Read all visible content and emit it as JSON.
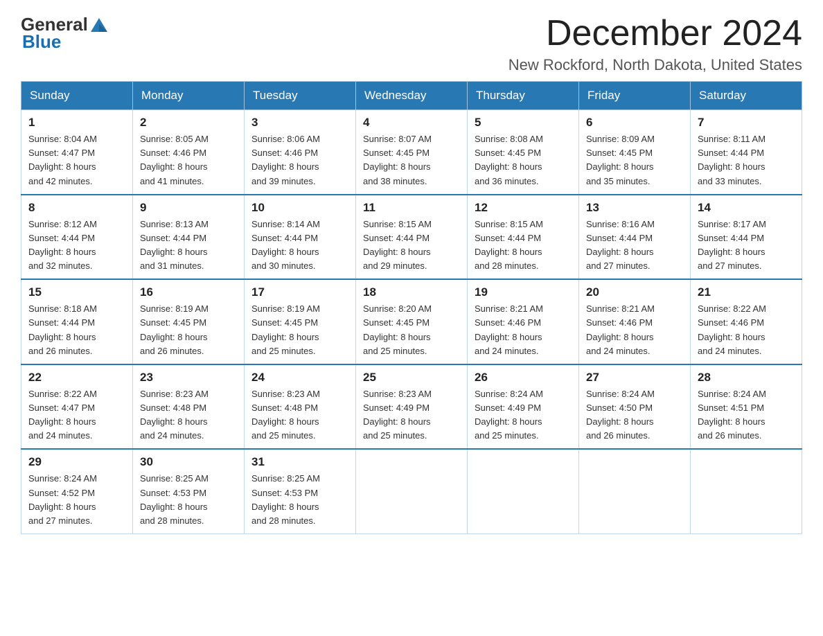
{
  "logo": {
    "text_general": "General",
    "text_blue": "Blue"
  },
  "header": {
    "month": "December 2024",
    "location": "New Rockford, North Dakota, United States"
  },
  "weekdays": [
    "Sunday",
    "Monday",
    "Tuesday",
    "Wednesday",
    "Thursday",
    "Friday",
    "Saturday"
  ],
  "weeks": [
    [
      {
        "day": "1",
        "sunrise": "8:04 AM",
        "sunset": "4:47 PM",
        "daylight": "8 hours and 42 minutes."
      },
      {
        "day": "2",
        "sunrise": "8:05 AM",
        "sunset": "4:46 PM",
        "daylight": "8 hours and 41 minutes."
      },
      {
        "day": "3",
        "sunrise": "8:06 AM",
        "sunset": "4:46 PM",
        "daylight": "8 hours and 39 minutes."
      },
      {
        "day": "4",
        "sunrise": "8:07 AM",
        "sunset": "4:45 PM",
        "daylight": "8 hours and 38 minutes."
      },
      {
        "day": "5",
        "sunrise": "8:08 AM",
        "sunset": "4:45 PM",
        "daylight": "8 hours and 36 minutes."
      },
      {
        "day": "6",
        "sunrise": "8:09 AM",
        "sunset": "4:45 PM",
        "daylight": "8 hours and 35 minutes."
      },
      {
        "day": "7",
        "sunrise": "8:11 AM",
        "sunset": "4:44 PM",
        "daylight": "8 hours and 33 minutes."
      }
    ],
    [
      {
        "day": "8",
        "sunrise": "8:12 AM",
        "sunset": "4:44 PM",
        "daylight": "8 hours and 32 minutes."
      },
      {
        "day": "9",
        "sunrise": "8:13 AM",
        "sunset": "4:44 PM",
        "daylight": "8 hours and 31 minutes."
      },
      {
        "day": "10",
        "sunrise": "8:14 AM",
        "sunset": "4:44 PM",
        "daylight": "8 hours and 30 minutes."
      },
      {
        "day": "11",
        "sunrise": "8:15 AM",
        "sunset": "4:44 PM",
        "daylight": "8 hours and 29 minutes."
      },
      {
        "day": "12",
        "sunrise": "8:15 AM",
        "sunset": "4:44 PM",
        "daylight": "8 hours and 28 minutes."
      },
      {
        "day": "13",
        "sunrise": "8:16 AM",
        "sunset": "4:44 PM",
        "daylight": "8 hours and 27 minutes."
      },
      {
        "day": "14",
        "sunrise": "8:17 AM",
        "sunset": "4:44 PM",
        "daylight": "8 hours and 27 minutes."
      }
    ],
    [
      {
        "day": "15",
        "sunrise": "8:18 AM",
        "sunset": "4:44 PM",
        "daylight": "8 hours and 26 minutes."
      },
      {
        "day": "16",
        "sunrise": "8:19 AM",
        "sunset": "4:45 PM",
        "daylight": "8 hours and 26 minutes."
      },
      {
        "day": "17",
        "sunrise": "8:19 AM",
        "sunset": "4:45 PM",
        "daylight": "8 hours and 25 minutes."
      },
      {
        "day": "18",
        "sunrise": "8:20 AM",
        "sunset": "4:45 PM",
        "daylight": "8 hours and 25 minutes."
      },
      {
        "day": "19",
        "sunrise": "8:21 AM",
        "sunset": "4:46 PM",
        "daylight": "8 hours and 24 minutes."
      },
      {
        "day": "20",
        "sunrise": "8:21 AM",
        "sunset": "4:46 PM",
        "daylight": "8 hours and 24 minutes."
      },
      {
        "day": "21",
        "sunrise": "8:22 AM",
        "sunset": "4:46 PM",
        "daylight": "8 hours and 24 minutes."
      }
    ],
    [
      {
        "day": "22",
        "sunrise": "8:22 AM",
        "sunset": "4:47 PM",
        "daylight": "8 hours and 24 minutes."
      },
      {
        "day": "23",
        "sunrise": "8:23 AM",
        "sunset": "4:48 PM",
        "daylight": "8 hours and 24 minutes."
      },
      {
        "day": "24",
        "sunrise": "8:23 AM",
        "sunset": "4:48 PM",
        "daylight": "8 hours and 25 minutes."
      },
      {
        "day": "25",
        "sunrise": "8:23 AM",
        "sunset": "4:49 PM",
        "daylight": "8 hours and 25 minutes."
      },
      {
        "day": "26",
        "sunrise": "8:24 AM",
        "sunset": "4:49 PM",
        "daylight": "8 hours and 25 minutes."
      },
      {
        "day": "27",
        "sunrise": "8:24 AM",
        "sunset": "4:50 PM",
        "daylight": "8 hours and 26 minutes."
      },
      {
        "day": "28",
        "sunrise": "8:24 AM",
        "sunset": "4:51 PM",
        "daylight": "8 hours and 26 minutes."
      }
    ],
    [
      {
        "day": "29",
        "sunrise": "8:24 AM",
        "sunset": "4:52 PM",
        "daylight": "8 hours and 27 minutes."
      },
      {
        "day": "30",
        "sunrise": "8:25 AM",
        "sunset": "4:53 PM",
        "daylight": "8 hours and 28 minutes."
      },
      {
        "day": "31",
        "sunrise": "8:25 AM",
        "sunset": "4:53 PM",
        "daylight": "8 hours and 28 minutes."
      },
      null,
      null,
      null,
      null
    ]
  ],
  "labels": {
    "sunrise": "Sunrise:",
    "sunset": "Sunset:",
    "daylight": "Daylight:"
  }
}
